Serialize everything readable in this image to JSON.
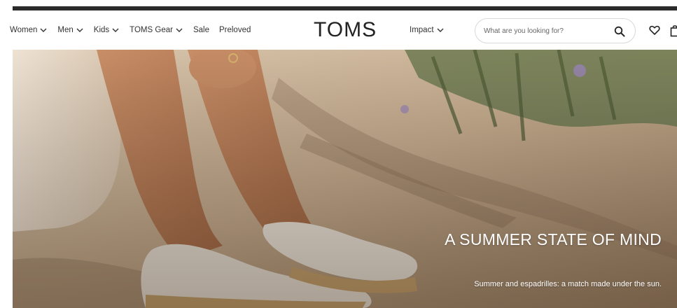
{
  "nav": {
    "items": [
      {
        "label": "Women",
        "has_dropdown": true
      },
      {
        "label": "Men",
        "has_dropdown": true
      },
      {
        "label": "Kids",
        "has_dropdown": true
      },
      {
        "label": "TOMS Gear",
        "has_dropdown": true
      },
      {
        "label": "Sale",
        "has_dropdown": false
      },
      {
        "label": "Preloved",
        "has_dropdown": false
      }
    ],
    "impact_label": "Impact"
  },
  "brand": {
    "logo_text": "TOMS"
  },
  "search": {
    "placeholder": "What are you looking for?",
    "value": ""
  },
  "icons": {
    "search": "search-icon",
    "wishlist": "heart-icon",
    "cart": "bag-icon",
    "dropdown": "chevron-down-icon"
  },
  "hero": {
    "title": "A SUMMER STATE OF MIND",
    "subtitle": "Summer and espadrilles: a match made under the sun."
  },
  "colors": {
    "top_bar": "#2b2b2b",
    "header_bg": "#ffffff",
    "text": "#222222",
    "hero_text": "#ffffff"
  }
}
